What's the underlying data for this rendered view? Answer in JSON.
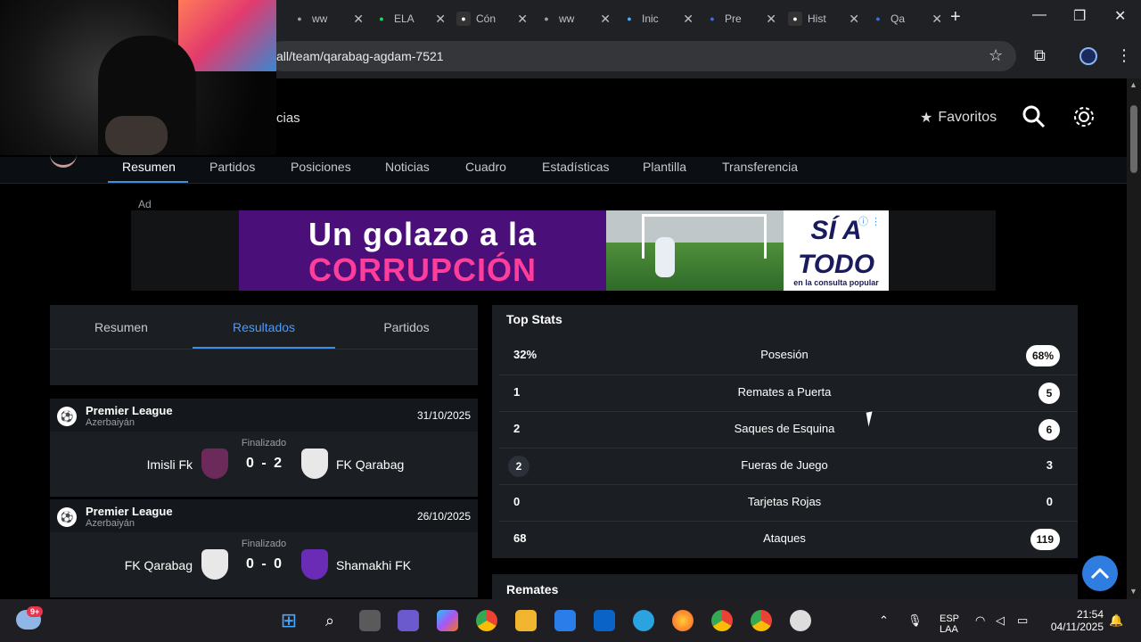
{
  "browser": {
    "tabs": [
      {
        "label": "ww",
        "icon": "globe-icon",
        "color": "#9aa0a6"
      },
      {
        "label": "ELA",
        "icon": "k-icon",
        "color": "#1ed760"
      },
      {
        "label": "Cón",
        "icon": "tiktok-icon",
        "color": "#ffffff"
      },
      {
        "label": "ww",
        "icon": "globe-icon",
        "color": "#9aa0a6"
      },
      {
        "label": "Inic",
        "icon": "copilot-icon",
        "color": "#4aa8ff"
      },
      {
        "label": "Pre",
        "icon": "at-icon",
        "color": "#3b6ee8"
      },
      {
        "label": "Hist",
        "icon": "inv-icon",
        "color": "#ffffff"
      },
      {
        "label": "Qa",
        "icon": "s-icon",
        "color": "#3b6ee8"
      }
    ],
    "url": "all/team/qarabag-agdam-7521"
  },
  "site": {
    "nav_partial": "cias",
    "favorites_label": "Favoritos",
    "subnav": [
      "Resumen",
      "Partidos",
      "Posiciones",
      "Noticias",
      "Cuadro",
      "Estadísticas",
      "Plantilla",
      "Transferencia"
    ],
    "ad": {
      "label": "Ad",
      "line1": "Un golazo a la",
      "line2": "CORRUPCIÓN",
      "right_big1": "SÍ A",
      "right_big2": "TODO",
      "right_small": "en la consulta popular"
    }
  },
  "left_panel": {
    "tabs": [
      "Resumen",
      "Resultados",
      "Partidos"
    ],
    "active_tab": "Resultados",
    "matches": [
      {
        "league": "Premier League",
        "country": "Azerbaiyán",
        "date": "31/10/2025",
        "status": "Finalizado",
        "home": "Imisli Fk",
        "away": "FK Qarabag",
        "score": "0 - 2"
      },
      {
        "league": "Premier League",
        "country": "Azerbaiyán",
        "date": "26/10/2025",
        "status": "Finalizado",
        "home": "FK Qarabag",
        "away": "Shamakhi FK",
        "score": "0 - 0"
      }
    ]
  },
  "top_stats": {
    "title": "Top Stats",
    "rows": [
      {
        "left": "32%",
        "label": "Posesión",
        "right": "68%",
        "winner": "right"
      },
      {
        "left": "1",
        "label": "Remates a Puerta",
        "right": "5",
        "winner": "right"
      },
      {
        "left": "2",
        "label": "Saques de Esquina",
        "right": "6",
        "winner": "right"
      },
      {
        "left": "2",
        "label": "Fueras de Juego",
        "right": "3",
        "winner": "left"
      },
      {
        "left": "0",
        "label": "Tarjetas Rojas",
        "right": "0",
        "winner": "none"
      },
      {
        "left": "68",
        "label": "Ataques",
        "right": "119",
        "winner": "right"
      }
    ],
    "next_section": "Remates"
  },
  "taskbar": {
    "weather_badge": "9+",
    "lang1": "ESP",
    "lang2": "LAA",
    "time": "21:54",
    "date": "04/11/2025"
  }
}
